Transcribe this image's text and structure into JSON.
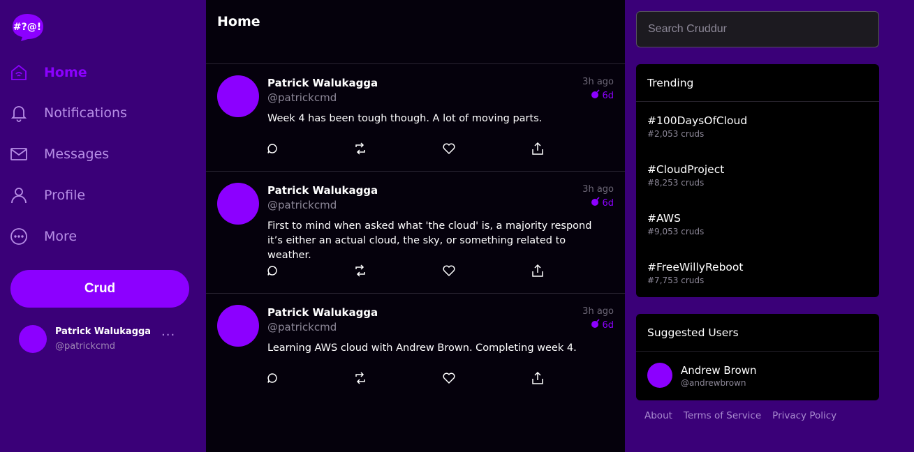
{
  "colors": {
    "accent": "#8c00ff",
    "sidebar_bg": "#3a0078",
    "feed_bg": "#05010c"
  },
  "logo": {
    "text": "#?@!"
  },
  "nav": [
    {
      "label": "Home",
      "icon": "home-icon",
      "active": true
    },
    {
      "label": "Notifications",
      "icon": "bell-icon"
    },
    {
      "label": "Messages",
      "icon": "envelope-icon"
    },
    {
      "label": "Profile",
      "icon": "user-icon"
    },
    {
      "label": "More",
      "icon": "more-circle-icon"
    }
  ],
  "crud_button": "Crud",
  "current_user": {
    "name": "Patrick Walukagga",
    "handle": "@patrickcmd",
    "menu": "···"
  },
  "feed": {
    "title": "Home",
    "posts": [
      {
        "name": "Patrick Walukagga",
        "handle": "@patrickcmd",
        "time": "3h ago",
        "expires": "6d",
        "text": "Week 4 has been tough though. A lot of moving parts."
      },
      {
        "name": "Patrick Walukagga",
        "handle": "@patrickcmd",
        "time": "3h ago",
        "expires": "6d",
        "text": "First to mind when asked what 'the cloud' is, a majority respond it’s either an actual cloud, the sky, or something related to weather."
      },
      {
        "name": "Patrick Walukagga",
        "handle": "@patrickcmd",
        "time": "3h ago",
        "expires": "6d",
        "text": "Learning AWS cloud with Andrew Brown. Completing week 4."
      }
    ]
  },
  "search": {
    "placeholder": "Search Cruddur"
  },
  "trending": {
    "title": "Trending",
    "items": [
      {
        "tag": "#100DaysOfCloud",
        "count": "#2,053 cruds"
      },
      {
        "tag": "#CloudProject",
        "count": "#8,253 cruds"
      },
      {
        "tag": "#AWS",
        "count": "#9,053 cruds"
      },
      {
        "tag": "#FreeWillyReboot",
        "count": "#7,753 cruds"
      }
    ]
  },
  "suggested": {
    "title": "Suggested Users",
    "users": [
      {
        "name": "Andrew Brown",
        "handle": "@andrewbrown"
      }
    ]
  },
  "footer": {
    "about": "About",
    "terms": "Terms of Service",
    "privacy": "Privacy Policy"
  }
}
